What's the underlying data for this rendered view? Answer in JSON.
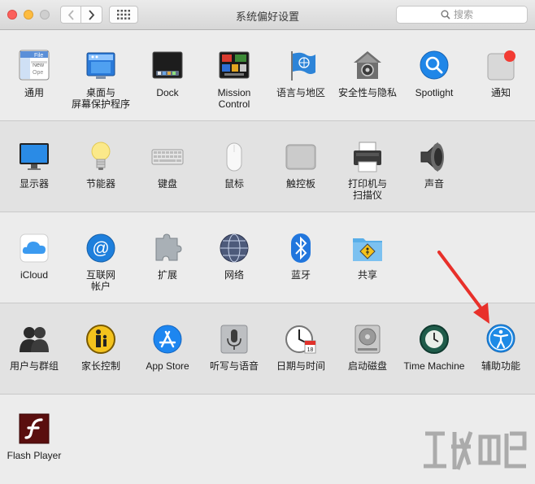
{
  "window": {
    "title": "系统偏好设置",
    "search_placeholder": "搜索"
  },
  "sections": [
    {
      "items": [
        {
          "label": "通用",
          "icon": "general-icon"
        },
        {
          "label": "桌面与\n屏幕保护程序",
          "icon": "desktop-screensaver-icon"
        },
        {
          "label": "Dock",
          "icon": "dock-icon"
        },
        {
          "label": "Mission\nControl",
          "icon": "mission-control-icon"
        },
        {
          "label": "语言与地区",
          "icon": "language-region-icon"
        },
        {
          "label": "安全性与隐私",
          "icon": "security-privacy-icon"
        },
        {
          "label": "Spotlight",
          "icon": "spotlight-icon"
        },
        {
          "label": "通知",
          "icon": "notifications-icon"
        }
      ]
    },
    {
      "items": [
        {
          "label": "显示器",
          "icon": "displays-icon"
        },
        {
          "label": "节能器",
          "icon": "energy-saver-icon"
        },
        {
          "label": "键盘",
          "icon": "keyboard-icon"
        },
        {
          "label": "鼠标",
          "icon": "mouse-icon"
        },
        {
          "label": "触控板",
          "icon": "trackpad-icon"
        },
        {
          "label": "打印机与\n扫描仪",
          "icon": "printers-scanners-icon"
        },
        {
          "label": "声音",
          "icon": "sound-icon"
        }
      ]
    },
    {
      "items": [
        {
          "label": "iCloud",
          "icon": "icloud-icon"
        },
        {
          "label": "互联网\n帐户",
          "icon": "internet-accounts-icon"
        },
        {
          "label": "扩展",
          "icon": "extensions-icon"
        },
        {
          "label": "网络",
          "icon": "network-icon"
        },
        {
          "label": "蓝牙",
          "icon": "bluetooth-icon"
        },
        {
          "label": "共享",
          "icon": "sharing-icon"
        }
      ]
    },
    {
      "items": [
        {
          "label": "用户与群组",
          "icon": "users-groups-icon"
        },
        {
          "label": "家长控制",
          "icon": "parental-controls-icon"
        },
        {
          "label": "App Store",
          "icon": "app-store-icon"
        },
        {
          "label": "听写与语音",
          "icon": "dictation-speech-icon"
        },
        {
          "label": "日期与时间",
          "icon": "date-time-icon"
        },
        {
          "label": "启动磁盘",
          "icon": "startup-disk-icon"
        },
        {
          "label": "Time Machine",
          "icon": "time-machine-icon"
        },
        {
          "label": "辅助功能",
          "icon": "accessibility-icon"
        }
      ]
    },
    {
      "items": [
        {
          "label": "Flash Player",
          "icon": "flash-player-icon"
        }
      ]
    }
  ],
  "annotation": {
    "icon": "red-arrow-icon"
  },
  "watermark": {
    "icon": "watermark-logo-icon"
  },
  "colors": {
    "accent": "#1e8be6",
    "arrow": "#e8302a"
  }
}
